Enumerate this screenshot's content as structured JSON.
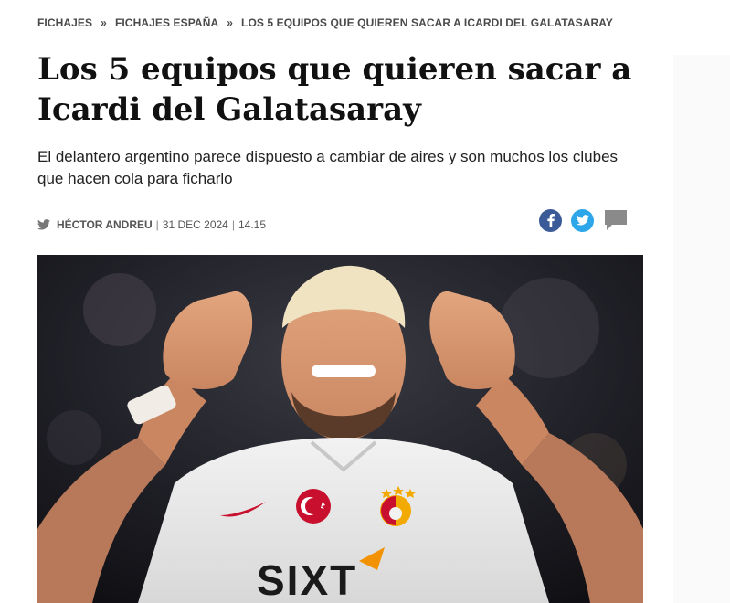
{
  "breadcrumb": {
    "items": [
      "FICHAJES",
      "FICHAJES ESPAÑA",
      "LOS 5 EQUIPOS QUE QUIEREN SACAR A ICARDI DEL GALATASARAY"
    ],
    "separator": "»"
  },
  "article": {
    "title": "Los 5 equipos que quieren sacar a Icardi del Galatasaray",
    "subtitle": "El delantero argentino parece dispuesto a cambiar de aires y son muchos los clubes que hacen cola para ficharlo",
    "author": "HÉCTOR ANDREU",
    "date": "31 DEC 2024",
    "time": "14.15",
    "divider": "|"
  },
  "share": {
    "icons": [
      "facebook-icon",
      "twitter-icon",
      "comment-icon"
    ]
  },
  "hero_image": {
    "shirt_text": "SIXT"
  },
  "colors": {
    "facebook": "#3b5a98",
    "twitter": "#2ea7ea",
    "comment": "#8a8a8a",
    "jersey_red": "#c8102e",
    "jersey_gold": "#f2a900"
  }
}
